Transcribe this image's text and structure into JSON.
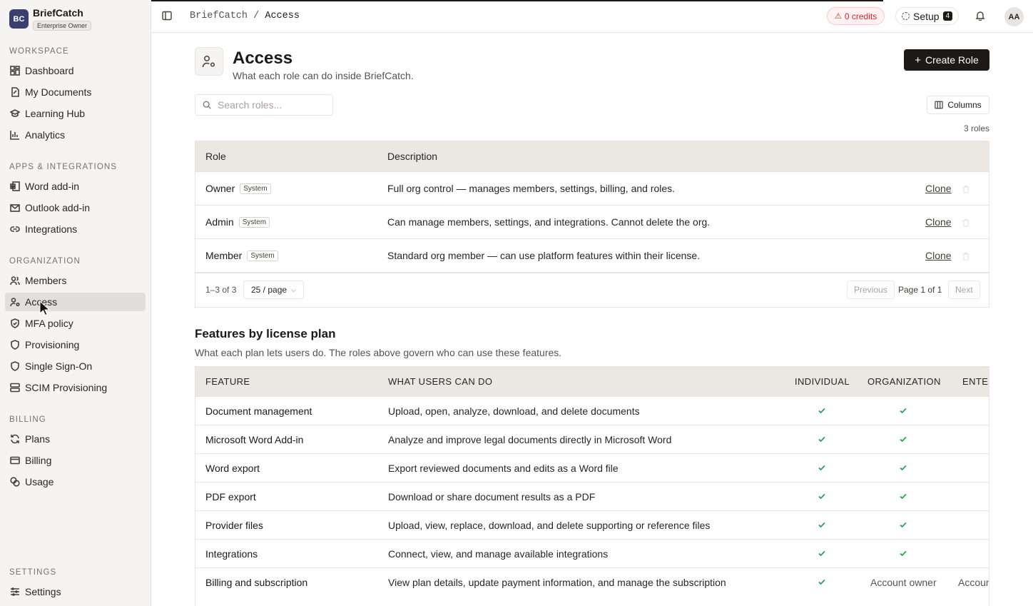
{
  "brand": {
    "logo": "BC",
    "name": "BriefCatch",
    "badge": "Enterprise Owner"
  },
  "sidebar": {
    "sections": [
      {
        "title": "Workspace",
        "items": [
          {
            "label": "Dashboard",
            "icon": "dashboard-icon"
          },
          {
            "label": "My Documents",
            "icon": "document-icon"
          },
          {
            "label": "Learning Hub",
            "icon": "graduation-cap-icon"
          },
          {
            "label": "Analytics",
            "icon": "bar-chart-icon"
          }
        ]
      },
      {
        "title": "Apps & Integrations",
        "items": [
          {
            "label": "Word add-in",
            "icon": "word-icon"
          },
          {
            "label": "Outlook add-in",
            "icon": "mail-icon"
          },
          {
            "label": "Integrations",
            "icon": "link-icon"
          }
        ]
      },
      {
        "title": "Organization",
        "items": [
          {
            "label": "Members",
            "icon": "users-icon"
          },
          {
            "label": "Access",
            "icon": "user-cog-icon",
            "active": true
          },
          {
            "label": "MFA policy",
            "icon": "shield-check-icon"
          },
          {
            "label": "Provisioning",
            "icon": "shield-icon"
          },
          {
            "label": "Single Sign-On",
            "icon": "shield-icon"
          },
          {
            "label": "SCIM Provisioning",
            "icon": "server-icon"
          }
        ]
      },
      {
        "title": "Billing",
        "items": [
          {
            "label": "Plans",
            "icon": "refresh-icon"
          },
          {
            "label": "Billing",
            "icon": "credit-card-icon"
          },
          {
            "label": "Usage",
            "icon": "coins-icon"
          }
        ]
      },
      {
        "title": "Settings",
        "items": [
          {
            "label": "Settings",
            "icon": "sliders-icon"
          }
        ]
      }
    ]
  },
  "topbar": {
    "breadcrumb_root": "BriefCatch",
    "breadcrumb_sep": "/",
    "breadcrumb_current": "Access",
    "credits": "0 credits",
    "setup_label": "Setup",
    "setup_count": "4",
    "avatar": "AA"
  },
  "page": {
    "title": "Access",
    "subtitle": "What each role can do inside BriefCatch.",
    "create_button": "Create Role",
    "search_placeholder": "Search roles...",
    "columns_button": "Columns",
    "roles_count": "3 roles"
  },
  "roles_table": {
    "headers": {
      "role": "Role",
      "description": "Description"
    },
    "rows": [
      {
        "role": "Owner",
        "tag": "System",
        "description": "Full org control — manages members, settings, billing, and roles.",
        "action": "Clone"
      },
      {
        "role": "Admin",
        "tag": "System",
        "description": "Can manage members, settings, and integrations. Cannot delete the org.",
        "action": "Clone"
      },
      {
        "role": "Member",
        "tag": "System",
        "description": "Standard org member — can use platform features within their license.",
        "action": "Clone"
      }
    ],
    "footer": {
      "range": "1–3 of 3",
      "per_page": "25 / page",
      "previous": "Previous",
      "page_of": "Page 1 of 1",
      "next": "Next"
    }
  },
  "features": {
    "title": "Features by license plan",
    "subtitle": "What each plan lets users do. The roles above govern who can use these features.",
    "headers": {
      "feature": "FEATURE",
      "what": "WHAT USERS CAN DO",
      "individual": "INDIVIDUAL",
      "organization": "ORGANIZATION",
      "enterprise": "ENTEI"
    },
    "rows": [
      {
        "feature": "Document management",
        "what": "Upload, open, analyze, download, and delete documents",
        "individual": "check",
        "organization": "check"
      },
      {
        "feature": "Microsoft Word Add-in",
        "what": "Analyze and improve legal documents directly in Microsoft Word",
        "individual": "check",
        "organization": "check"
      },
      {
        "feature": "Word export",
        "what": "Export reviewed documents and edits as a Word file",
        "individual": "check",
        "organization": "check"
      },
      {
        "feature": "PDF export",
        "what": "Download or share document results as a PDF",
        "individual": "check",
        "organization": "check"
      },
      {
        "feature": "Provider files",
        "what": "Upload, view, replace, download, and delete supporting or reference files",
        "individual": "check",
        "organization": "check"
      },
      {
        "feature": "Integrations",
        "what": "Connect, view, and manage available integrations",
        "individual": "check",
        "organization": "check"
      },
      {
        "feature": "Billing and subscription",
        "what": "View plan details, update payment information, and manage the subscription",
        "individual": "check",
        "organization": "Account owner",
        "enterprise": "Accour"
      }
    ]
  }
}
